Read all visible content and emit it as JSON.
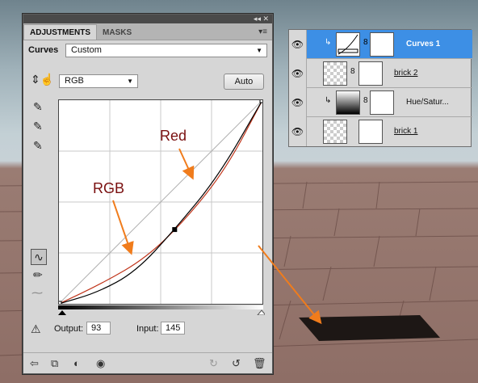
{
  "panel": {
    "tabs": [
      {
        "label": "ADJUSTMENTS",
        "active": true
      },
      {
        "label": "MASKS",
        "active": false
      }
    ],
    "title_controls": "◂◂  ✕",
    "menu_icon": "panel-menu-icon",
    "preset_label": "Curves",
    "preset_value": "Custom",
    "channel_value": "RGB",
    "auto_label": "Auto",
    "output_label": "Output:",
    "output_value": "93",
    "input_label": "Input:",
    "input_value": "145"
  },
  "curve": {
    "rgb_point": {
      "input": 145,
      "output": 93
    },
    "rgb_curve": [
      [
        0,
        0
      ],
      [
        48,
        14
      ],
      [
        96,
        40
      ],
      [
        145,
        93
      ],
      [
        200,
        160
      ],
      [
        255,
        255
      ]
    ],
    "red_curve": [
      [
        0,
        0
      ],
      [
        55,
        26
      ],
      [
        110,
        58
      ],
      [
        160,
        107
      ],
      [
        210,
        170
      ],
      [
        255,
        255
      ]
    ],
    "rgb_color": "#000000",
    "red_color": "#c0341a",
    "grid_divisions": 4
  },
  "annotations": {
    "red_label": "Red",
    "rgb_label": "RGB",
    "arrow_color": "#f07c1c"
  },
  "layers": [
    {
      "name": "Curves 1",
      "selected": true,
      "type": "adjustment"
    },
    {
      "name": "brick 2",
      "selected": false,
      "type": "image"
    },
    {
      "name": "Hue/Satur...",
      "selected": false,
      "type": "adjustment"
    },
    {
      "name": "brick 1",
      "selected": false,
      "type": "image"
    }
  ],
  "colors": {
    "layer_selected": "#3d8fe5",
    "panel_bg": "#d6d6d6"
  }
}
